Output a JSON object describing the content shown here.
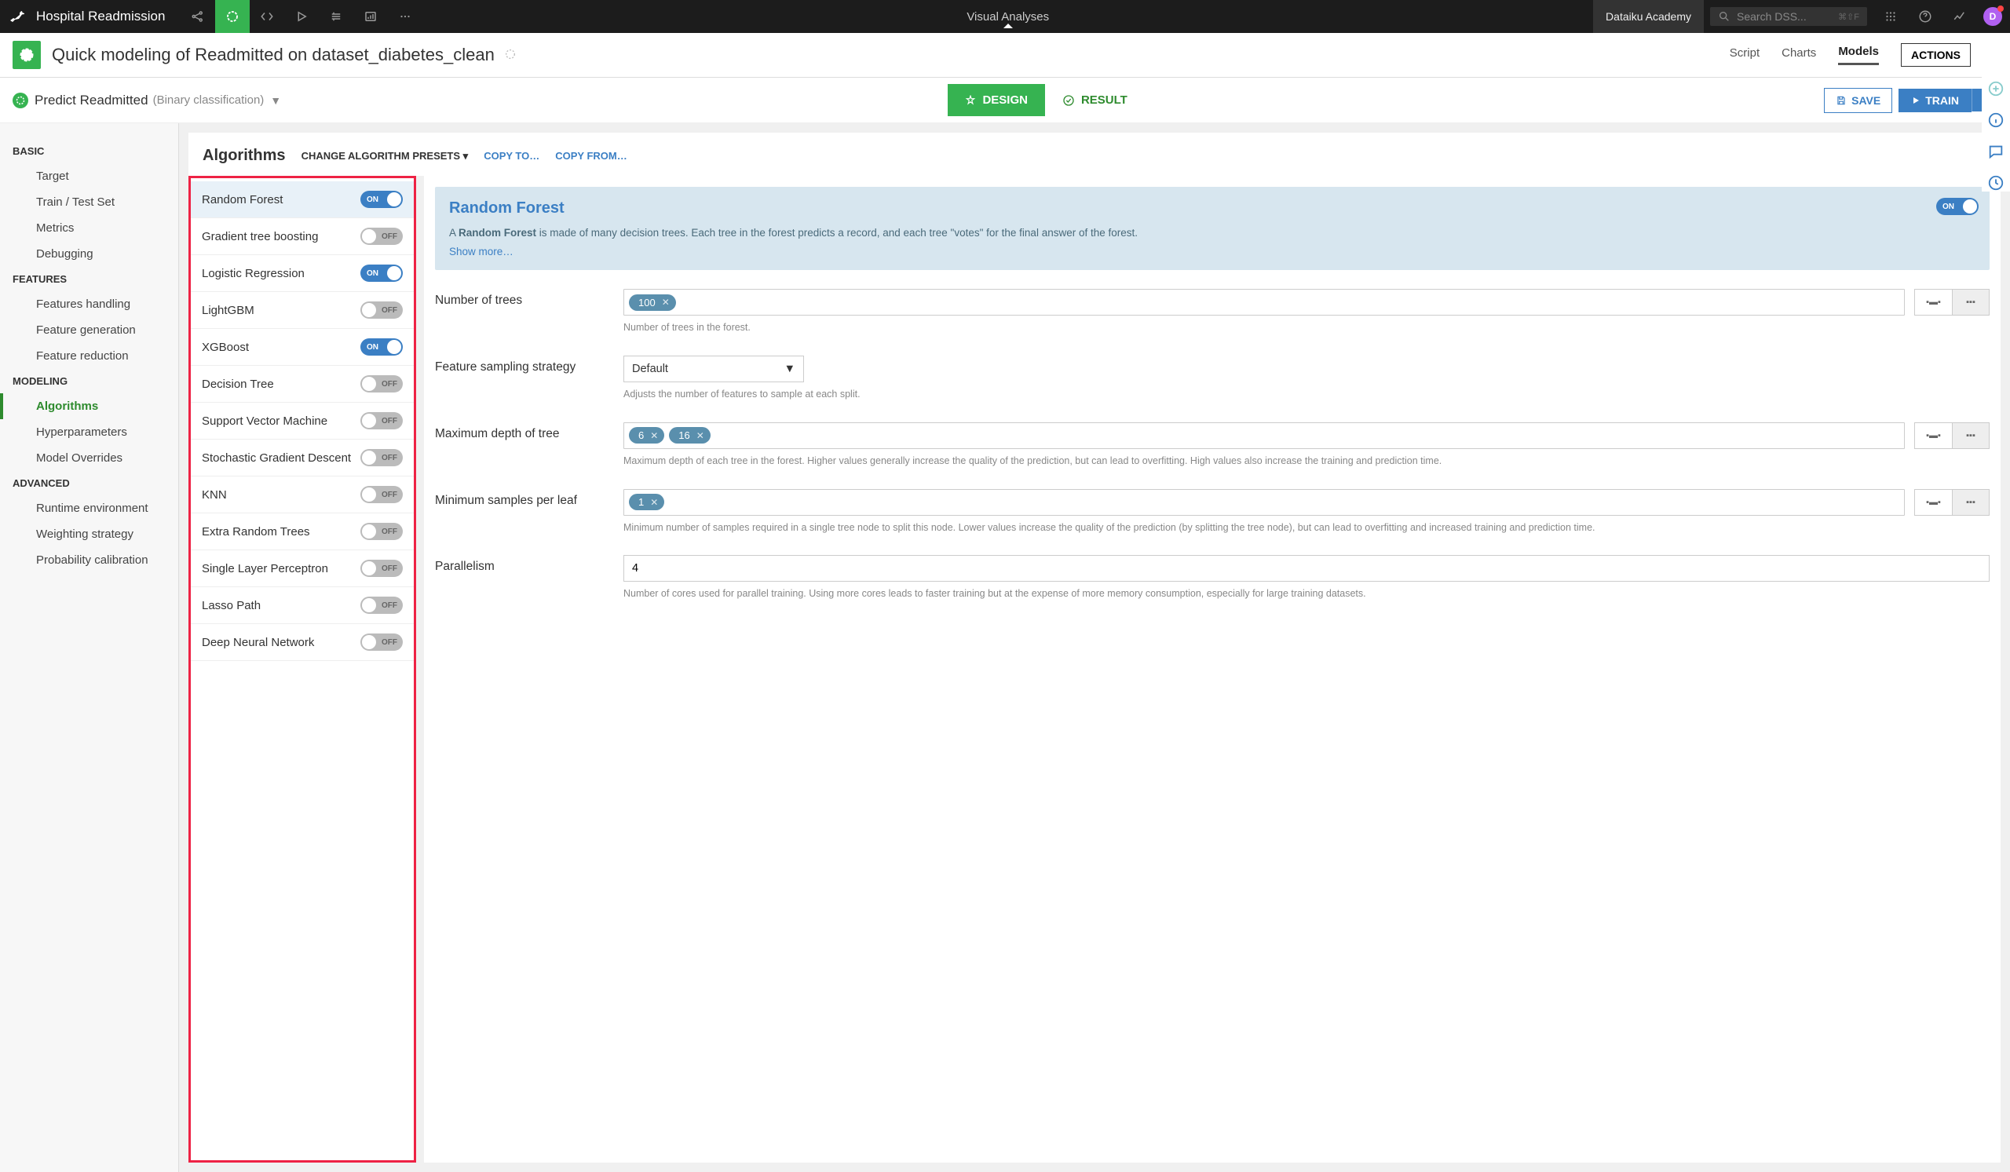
{
  "topbar": {
    "project": "Hospital Readmission",
    "center": "Visual Analyses",
    "academy": "Dataiku Academy",
    "search_placeholder": "Search DSS...",
    "shortcut": "⌘⇧F",
    "avatar_initial": "D"
  },
  "titlebar": {
    "title": "Quick modeling of Readmitted on dataset_diabetes_clean",
    "tabs": {
      "script": "Script",
      "charts": "Charts",
      "models": "Models"
    },
    "actions": "ACTIONS"
  },
  "subhead": {
    "title": "Predict Readmitted",
    "subtitle": "(Binary classification)",
    "design": "DESIGN",
    "result": "RESULT",
    "save": "SAVE",
    "train": "TRAIN"
  },
  "sidenav": {
    "basic": {
      "head": "BASIC",
      "items": [
        "Target",
        "Train / Test Set",
        "Metrics",
        "Debugging"
      ]
    },
    "features": {
      "head": "FEATURES",
      "items": [
        "Features handling",
        "Feature generation",
        "Feature reduction"
      ]
    },
    "modeling": {
      "head": "MODELING",
      "items": [
        "Algorithms",
        "Hyperparameters",
        "Model Overrides"
      ]
    },
    "advanced": {
      "head": "ADVANCED",
      "items": [
        "Runtime environment",
        "Weighting strategy",
        "Probability calibration"
      ]
    }
  },
  "algohead": {
    "title": "Algorithms",
    "preset": "CHANGE ALGORITHM PRESETS",
    "copyto": "COPY TO…",
    "copyfrom": "COPY FROM…"
  },
  "algorithms": [
    {
      "name": "Random Forest",
      "on": true,
      "selected": true
    },
    {
      "name": "Gradient tree boosting",
      "on": false
    },
    {
      "name": "Logistic Regression",
      "on": true
    },
    {
      "name": "LightGBM",
      "on": false
    },
    {
      "name": "XGBoost",
      "on": true
    },
    {
      "name": "Decision Tree",
      "on": false
    },
    {
      "name": "Support Vector Machine",
      "on": false
    },
    {
      "name": "Stochastic Gradient Descent",
      "on": false
    },
    {
      "name": "KNN",
      "on": false
    },
    {
      "name": "Extra Random Trees",
      "on": false
    },
    {
      "name": "Single Layer Perceptron",
      "on": false
    },
    {
      "name": "Lasso Path",
      "on": false
    },
    {
      "name": "Deep Neural Network",
      "on": false
    }
  ],
  "detail": {
    "title": "Random Forest",
    "desc_prefix": "A ",
    "desc_bold": "Random Forest",
    "desc_rest": " is made of many decision trees. Each tree in the forest predicts a record, and each tree \"votes\" for the final answer of the forest.",
    "show_more": "Show more…",
    "on_label": "ON",
    "params": {
      "ntrees": {
        "label": "Number of trees",
        "values": [
          "100"
        ],
        "help": "Number of trees in the forest."
      },
      "featsamp": {
        "label": "Feature sampling strategy",
        "value": "Default",
        "help": "Adjusts the number of features to sample at each split."
      },
      "maxdepth": {
        "label": "Maximum depth of tree",
        "values": [
          "6",
          "16"
        ],
        "help": "Maximum depth of each tree in the forest. Higher values generally increase the quality of the prediction, but can lead to overfitting. High values also increase the training and prediction time."
      },
      "minsamp": {
        "label": "Minimum samples per leaf",
        "values": [
          "1"
        ],
        "help": "Minimum number of samples required in a single tree node to split this node. Lower values increase the quality of the prediction (by splitting the tree node), but can lead to overfitting and increased training and prediction time."
      },
      "parallel": {
        "label": "Parallelism",
        "value": "4",
        "help": "Number of cores used for parallel training. Using more cores leads to faster training but at the expense of more memory consumption, especially for large training datasets."
      }
    }
  },
  "toggle_labels": {
    "on": "ON",
    "off": "OFF"
  }
}
